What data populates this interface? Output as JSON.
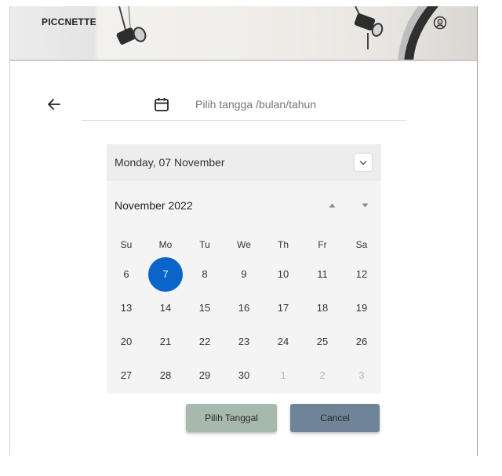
{
  "header": {
    "brand": "PICCNETTE"
  },
  "search": {
    "placeholder": "Pilih tangga /bulan/tahun"
  },
  "picker": {
    "selected_date": "Monday, 07 November",
    "month_label": "November 2022",
    "weekdays": [
      "Su",
      "Mo",
      "Tu",
      "We",
      "Th",
      "Fr",
      "Sa"
    ],
    "weeks": [
      [
        {
          "d": "6"
        },
        {
          "d": "7",
          "selected": true
        },
        {
          "d": "8"
        },
        {
          "d": "9"
        },
        {
          "d": "10"
        },
        {
          "d": "11"
        },
        {
          "d": "12"
        }
      ],
      [
        {
          "d": "13"
        },
        {
          "d": "14"
        },
        {
          "d": "15"
        },
        {
          "d": "16"
        },
        {
          "d": "17"
        },
        {
          "d": "18"
        },
        {
          "d": "19"
        }
      ],
      [
        {
          "d": "20"
        },
        {
          "d": "21"
        },
        {
          "d": "22"
        },
        {
          "d": "23"
        },
        {
          "d": "24"
        },
        {
          "d": "25"
        },
        {
          "d": "26"
        }
      ],
      [
        {
          "d": "27"
        },
        {
          "d": "28"
        },
        {
          "d": "29"
        },
        {
          "d": "30"
        },
        {
          "d": "1",
          "muted": true
        },
        {
          "d": "2",
          "muted": true
        },
        {
          "d": "3",
          "muted": true
        }
      ]
    ]
  },
  "actions": {
    "confirm_label": "Pilih Tanggal",
    "cancel_label": "Cancel"
  },
  "colors": {
    "selected_day": "#0a64c9",
    "confirm_button": "#a7b8ac",
    "cancel_button": "#6f8496"
  },
  "icons": [
    "back-arrow-icon",
    "calendar-icon",
    "chevron-down-icon",
    "triangle-up-icon",
    "triangle-down-icon",
    "user-icon",
    "studio-lamp-icon"
  ]
}
